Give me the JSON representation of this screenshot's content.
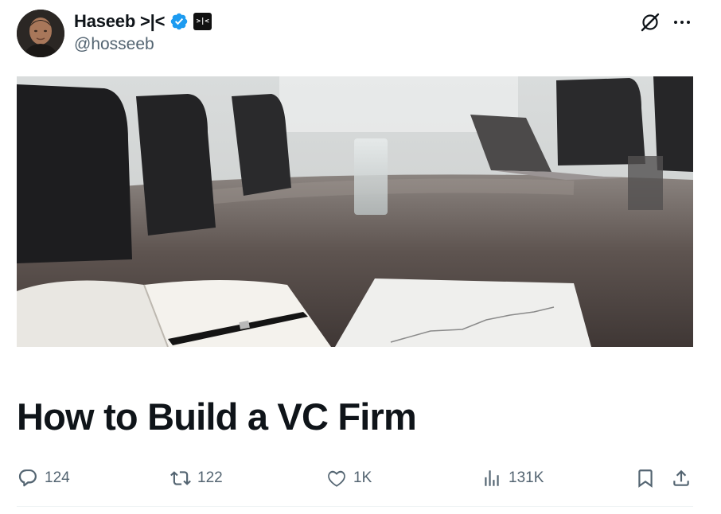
{
  "author": {
    "display_name": "Haseeb >|<",
    "handle": "@hosseeb",
    "verified": true,
    "affiliate_badge": ">|<",
    "avatar_icon": "user-avatar"
  },
  "header_icons": [
    "grok-icon",
    "more-icon"
  ],
  "article": {
    "title": "How to Build a VC Firm",
    "cover_image": "boardroom-table-photo"
  },
  "engagement": {
    "replies": "124",
    "reposts": "122",
    "likes": "1K",
    "views": "131K"
  },
  "colors": {
    "text": "#0f1419",
    "secondary": "#536471",
    "verified_blue": "#1d9bf0",
    "divider": "#eff3f4"
  }
}
